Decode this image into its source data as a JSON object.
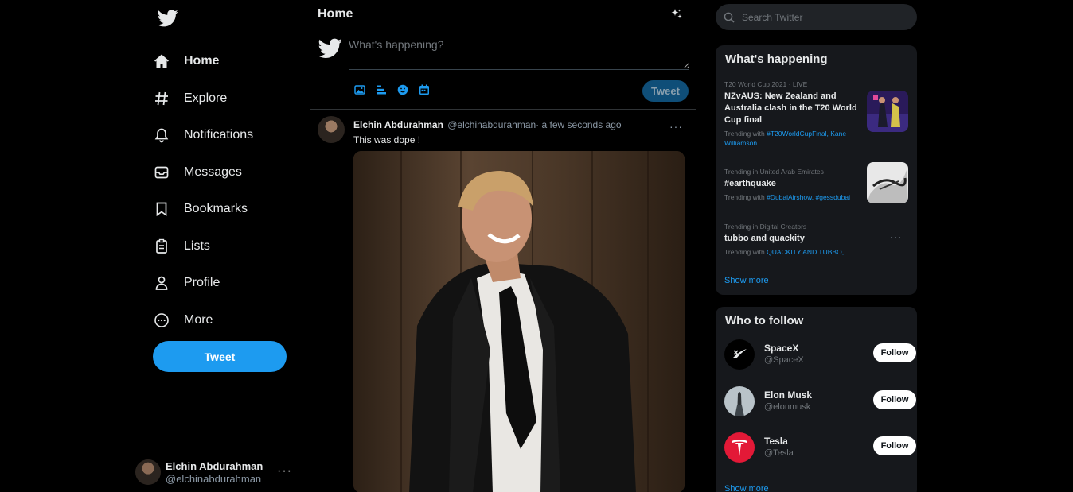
{
  "colors": {
    "accent": "#1d9bf0",
    "background": "#000000",
    "panel": "#16181c"
  },
  "sidebar": {
    "logo_icon": "twitter-bird-icon",
    "items": [
      {
        "label": "Home",
        "icon": "home-icon"
      },
      {
        "label": "Explore",
        "icon": "hashtag-icon"
      },
      {
        "label": "Notifications",
        "icon": "bell-icon"
      },
      {
        "label": "Messages",
        "icon": "envelope-icon"
      },
      {
        "label": "Bookmarks",
        "icon": "bookmark-icon"
      },
      {
        "label": "Lists",
        "icon": "list-icon"
      },
      {
        "label": "Profile",
        "icon": "person-icon"
      },
      {
        "label": "More",
        "icon": "more-circle-icon"
      }
    ],
    "tweet_button": "Tweet",
    "account": {
      "name": "Elchin Abdurahman",
      "handle": "@elchinabdurahman",
      "more": "···"
    }
  },
  "main": {
    "title": "Home",
    "composer": {
      "placeholder": "What's happening?",
      "tools": [
        "image-icon",
        "poll-icon",
        "emoji-icon",
        "schedule-icon"
      ],
      "tweet_button": "Tweet"
    },
    "tweet": {
      "name": "Elchin Abdurahman",
      "meta": "@elchinabdurahman· a few seconds ago",
      "text": "This was dope !",
      "more": "···"
    }
  },
  "right": {
    "search_placeholder": "Search Twitter",
    "happening": {
      "title": "What's happening",
      "trends": [
        {
          "meta": "T20 World Cup 2021 · LIVE",
          "topic": "NZvAUS: New Zealand and Australia clash in the T20 World Cup final",
          "with_label": "Trending with ",
          "tags": "#T20WorldCupFinal, Kane Williamson"
        },
        {
          "meta": "Trending in United Arab Emirates",
          "topic": "#earthquake",
          "with_label": "Trending with ",
          "tags": "#DubaiAirshow, #gessdubai"
        },
        {
          "meta": "Trending in Digital Creators",
          "topic": "tubbo and quackity",
          "with_label": "Trending with ",
          "tags": "QUACKITY AND TUBBO,"
        }
      ],
      "more": "···",
      "show_more": "Show more"
    },
    "follow": {
      "title": "Who to follow",
      "accounts": [
        {
          "name": "SpaceX",
          "handle": "@SpaceX",
          "button": "Follow"
        },
        {
          "name": "Elon Musk",
          "handle": "@elonmusk",
          "button": "Follow"
        },
        {
          "name": "Tesla",
          "handle": "@Tesla",
          "button": "Follow"
        }
      ],
      "show_more": "Show more"
    }
  }
}
